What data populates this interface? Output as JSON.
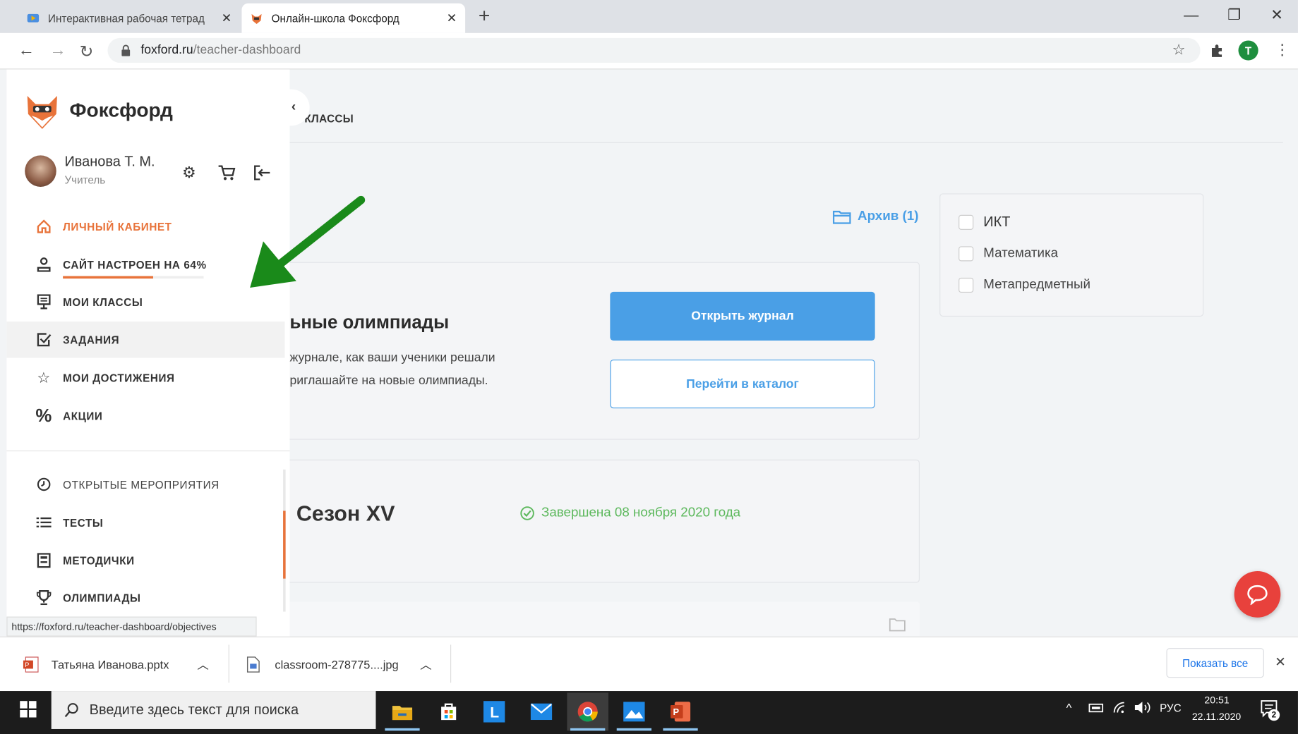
{
  "browser": {
    "tabs": [
      {
        "title": "Интерактивная рабочая тетрад",
        "active": false
      },
      {
        "title": "Онлайн-школа Фоксфорд",
        "active": true
      }
    ],
    "url_domain": "foxford.ru",
    "url_path": "/teacher-dashboard",
    "avatar_letter": "T",
    "status_url": "https://foxford.ru/teacher-dashboard/objectives"
  },
  "sidebar": {
    "brand": "Фоксфорд",
    "user_name": "Иванова Т. М.",
    "user_role": "Учитель",
    "menu_top": [
      {
        "label": "ЛИЧНЫЙ КАБИНЕТ",
        "icon": "home-icon"
      },
      {
        "label": "САЙТ НАСТРОЕН НА 64%",
        "icon": "person-icon",
        "progress": 0.64
      },
      {
        "label": "МОИ КЛАССЫ",
        "icon": "board-icon"
      },
      {
        "label": "ЗАДАНИЯ",
        "icon": "checkbox-icon"
      },
      {
        "label": "МОИ ДОСТИЖЕНИЯ",
        "icon": "star-icon"
      },
      {
        "label": "АКЦИИ",
        "icon": "percent-icon"
      }
    ],
    "menu_bottom": [
      {
        "label": "ОТКРЫТЫЕ МЕРОПРИЯТИЯ",
        "icon": "clock-icon"
      },
      {
        "label": "ТЕСТЫ",
        "icon": "list-icon"
      },
      {
        "label": "МЕТОДИЧКИ",
        "icon": "book-icon"
      },
      {
        "label": "ОЛИМПИАДЫ",
        "icon": "trophy-icon"
      }
    ]
  },
  "main": {
    "breadcrumb": ". КЛАССЫ",
    "archive_label": "Архив (1)",
    "olympiad_title": "ьные олимпиады",
    "olympiad_text_1": "журнале, как ваши ученики решали",
    "olympiad_text_2": "риглашайте на новые олимпиады.",
    "open_journal": "Открыть журнал",
    "go_catalog": "Перейти в каталог",
    "season_title": "Сезон XV",
    "season_status": "Завершена 08 ноября 2020 года",
    "filters": [
      "ИКТ",
      "Математика",
      "Метапредметный"
    ]
  },
  "downloads": {
    "items": [
      "Татьяна Иванова.pptx",
      "classroom-278775....jpg"
    ],
    "show_all": "Показать все"
  },
  "taskbar": {
    "search_placeholder": "Введите здесь текст для поиска",
    "lang": "РУС",
    "time": "20:51",
    "date": "22.11.2020",
    "notif_count": "2"
  },
  "colors": {
    "accent": "#4a9fe6",
    "orange": "#e8733a",
    "green": "#5cb85c",
    "arrow": "#1a8a1a",
    "chat": "#e8413c"
  }
}
